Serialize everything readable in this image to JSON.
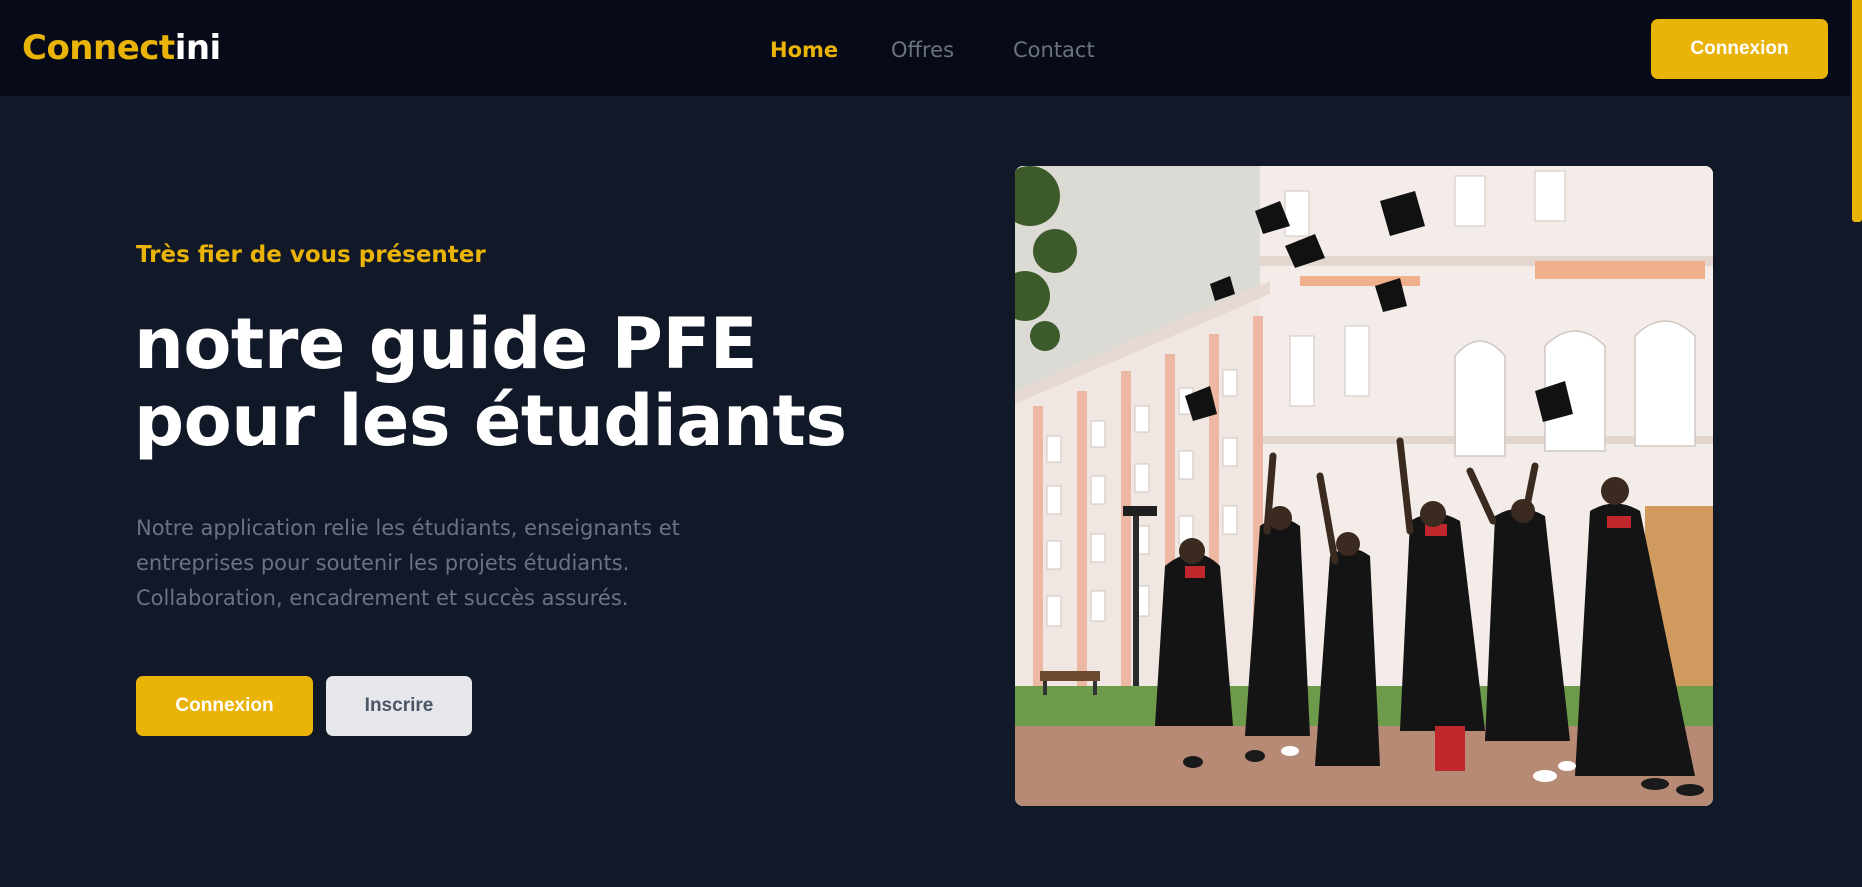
{
  "header": {
    "logo_part1": "Connect",
    "logo_part2": "ini",
    "nav": {
      "home": "Home",
      "offres": "Offres",
      "contact": "Contact"
    },
    "login_label": "Connexion"
  },
  "hero": {
    "tagline": "Très fier de vous présenter",
    "title_line1": "notre guide PFE",
    "title_line2": "pour les étudiants",
    "description_line1": "Notre application relie les étudiants, enseignants et",
    "description_line2": "entreprises pour soutenir les projets étudiants.",
    "description_line3": "Collaboration, encadrement et succès assurés.",
    "primary_button": "Connexion",
    "secondary_button": "Inscrire",
    "image_icon": "graduation-photo"
  },
  "colors": {
    "accent": "#eab308",
    "background": "#111827",
    "header_bg": "#070b19",
    "muted_text": "#6b7280",
    "secondary_button_bg": "#e5e7eb"
  }
}
